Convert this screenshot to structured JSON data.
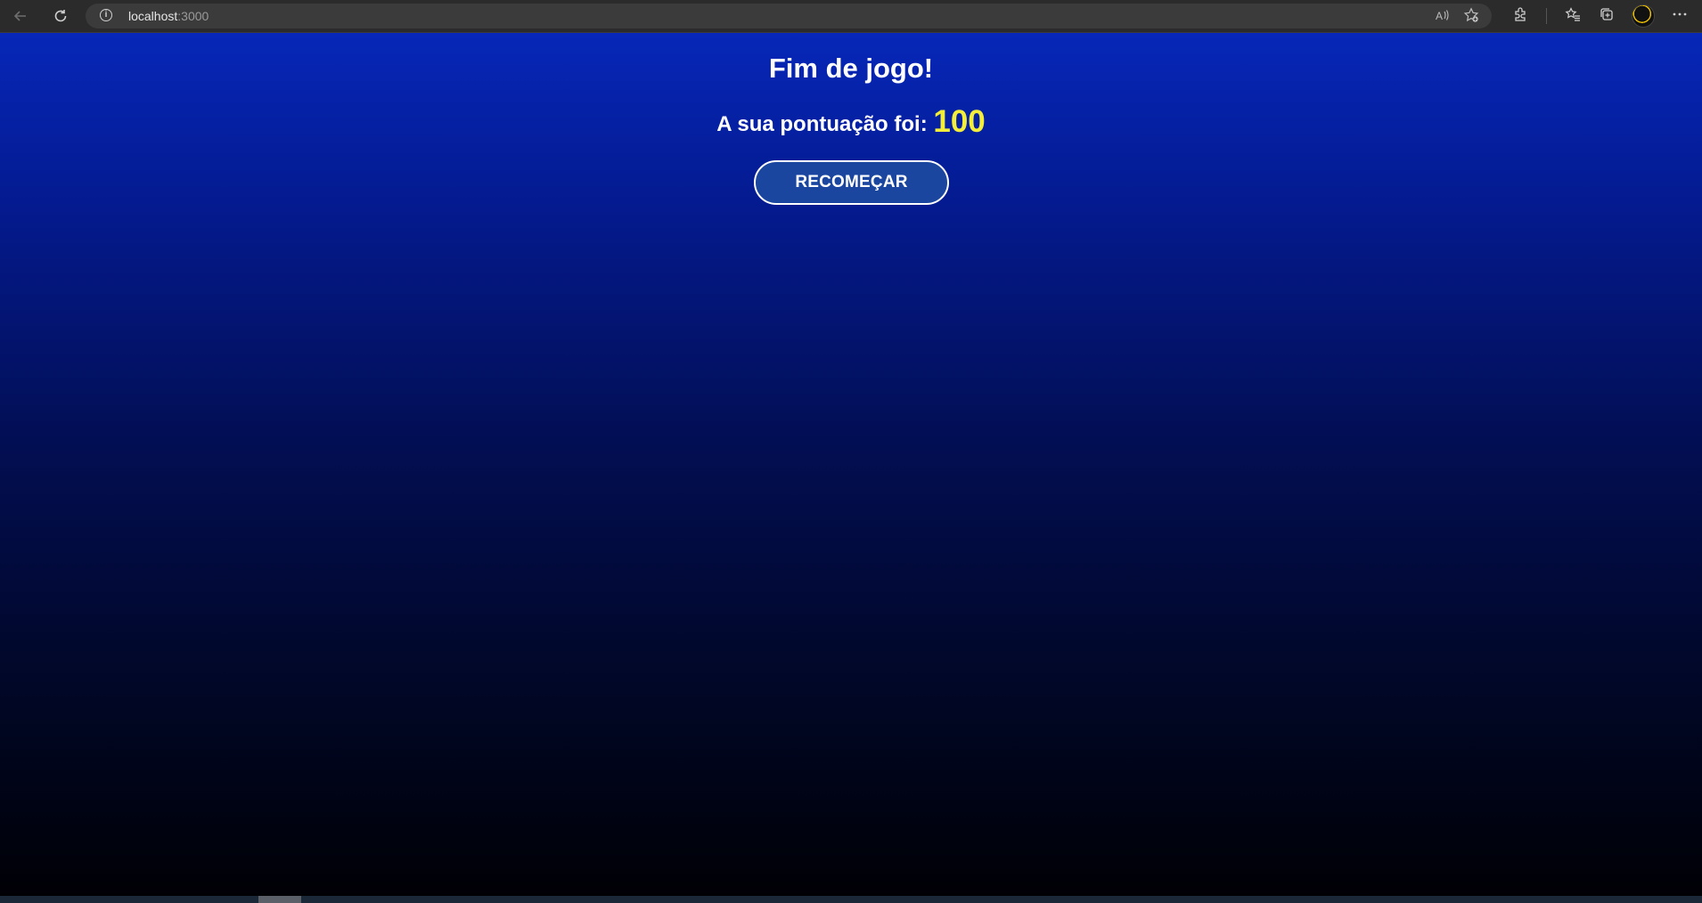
{
  "browser": {
    "url_host": "localhost",
    "url_port": ":3000",
    "icons": {
      "back": "back-arrow-icon",
      "reload": "reload-icon",
      "info": "site-info-icon",
      "read_aloud": "read-aloud-icon",
      "add_favorite": "add-favorite-icon",
      "extensions": "extensions-icon",
      "favorites": "favorites-icon",
      "collections": "collections-icon",
      "profile": "profile-avatar",
      "menu": "more-menu-icon"
    },
    "read_aloud_glyph": "A))",
    "menu_glyph": "···"
  },
  "game_over": {
    "title": "Fim de jogo!",
    "score_label": "A sua pontuação foi:",
    "score_value": "100",
    "restart_label": "RECOMEÇAR"
  },
  "colors": {
    "background_top": "#0627b8",
    "background_bottom": "#000005",
    "score_highlight": "#f2ee3a",
    "button_fill": "#1a46a0",
    "button_border": "#ffffff",
    "text": "#ffffff"
  }
}
